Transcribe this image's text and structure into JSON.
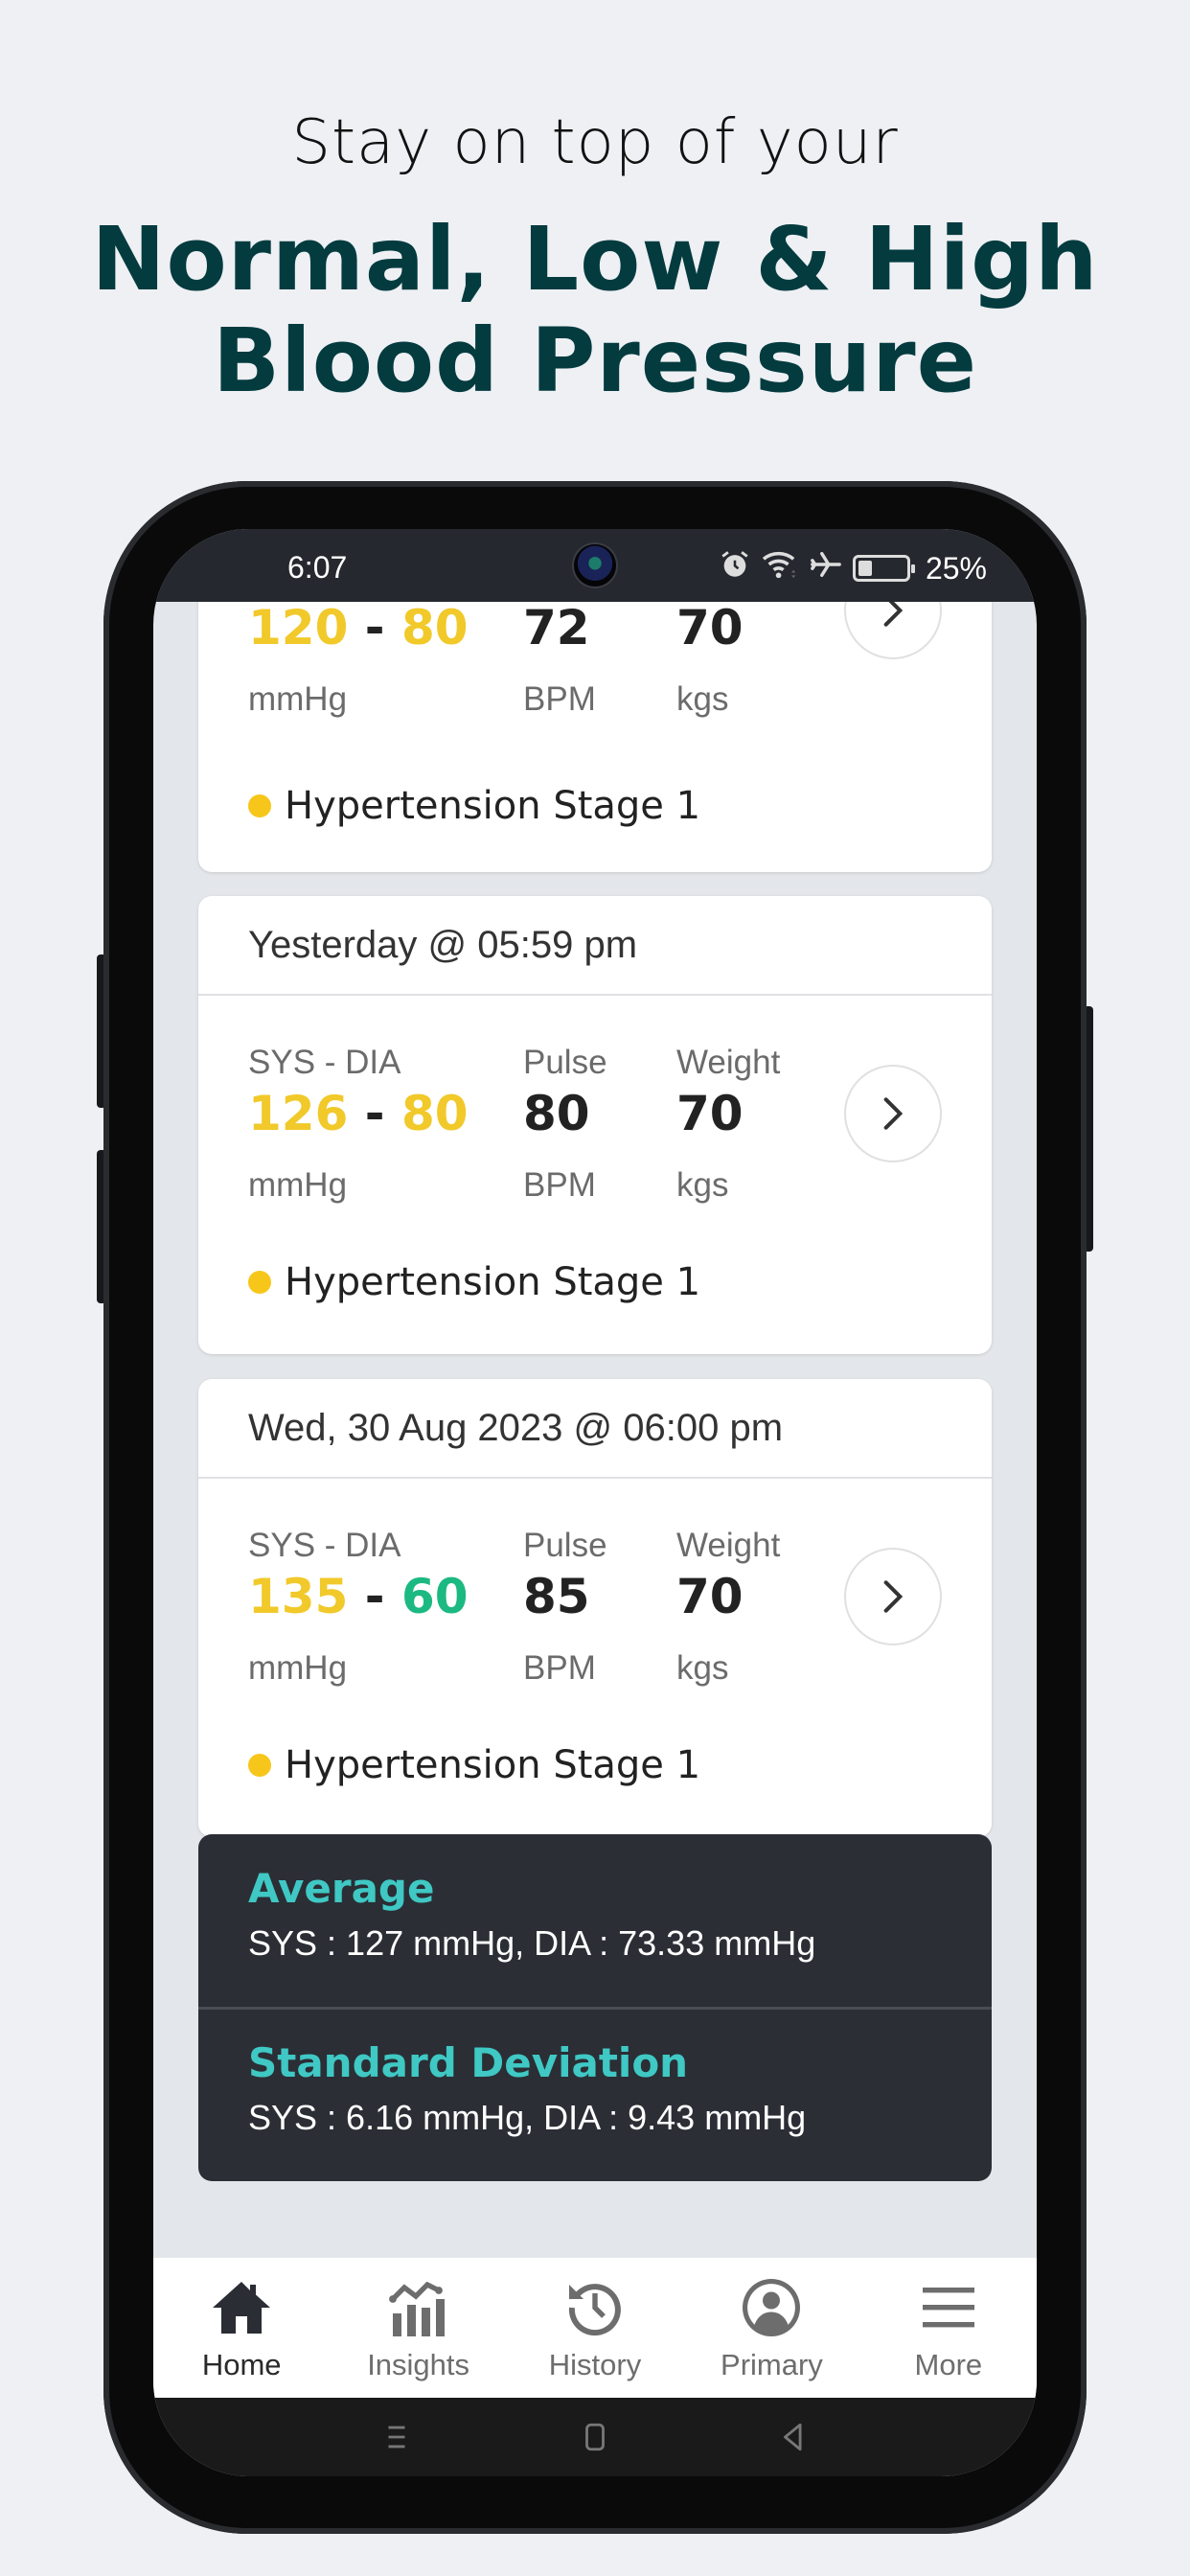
{
  "promo": {
    "subtitle": "Stay on top of your",
    "title_line1": "Normal, Low & High",
    "title_line2": "Blood Pressure"
  },
  "statusbar": {
    "time": "6:07",
    "battery": "25%",
    "icons": [
      "alarm-icon",
      "wifi-icon",
      "airplane-icon",
      "battery-icon"
    ]
  },
  "labels": {
    "sys_dia": "SYS - DIA",
    "pulse": "Pulse",
    "weight": "Weight",
    "unit_bp": "mmHg",
    "unit_pulse": "BPM",
    "unit_weight": "kgs",
    "dash": " - "
  },
  "readings": [
    {
      "date": "",
      "sys": "120",
      "dia": "80",
      "pulse": "72",
      "weight": "70",
      "status": "Hypertension Stage 1",
      "sys_color": "#f1c92a",
      "dia_color": "#f1c92a",
      "status_color": "#f7c61a"
    },
    {
      "date": "Yesterday @ 05:59 pm",
      "sys": "126",
      "dia": "80",
      "pulse": "80",
      "weight": "70",
      "status": "Hypertension Stage 1",
      "sys_color": "#f1c92a",
      "dia_color": "#f1c92a",
      "status_color": "#f7c61a"
    },
    {
      "date": "Wed, 30 Aug 2023 @ 06:00 pm",
      "sys": "135",
      "dia": "60",
      "pulse": "85",
      "weight": "70",
      "status": "Hypertension Stage 1",
      "sys_color": "#f1c92a",
      "dia_color": "#1cb982",
      "status_color": "#f7c61a"
    }
  ],
  "stats": {
    "average_title": "Average",
    "average_value": "SYS : 127 mmHg, DIA : 73.33 mmHg",
    "stddev_title": "Standard Deviation",
    "stddev_value": "SYS : 6.16 mmHg, DIA : 9.43 mmHg",
    "accent": "#3fc8c4"
  },
  "tabbar": {
    "items": [
      {
        "label": "Home",
        "icon": "home-icon",
        "active": true
      },
      {
        "label": "Insights",
        "icon": "insights-chart-icon",
        "active": false
      },
      {
        "label": "History",
        "icon": "history-clock-icon",
        "active": false
      },
      {
        "label": "Primary",
        "icon": "user-profile-icon",
        "active": false
      },
      {
        "label": "More",
        "icon": "hamburger-menu-icon",
        "active": false
      }
    ]
  },
  "sysnav": {
    "items": [
      "recents-icon",
      "home-button-icon",
      "back-icon"
    ]
  }
}
